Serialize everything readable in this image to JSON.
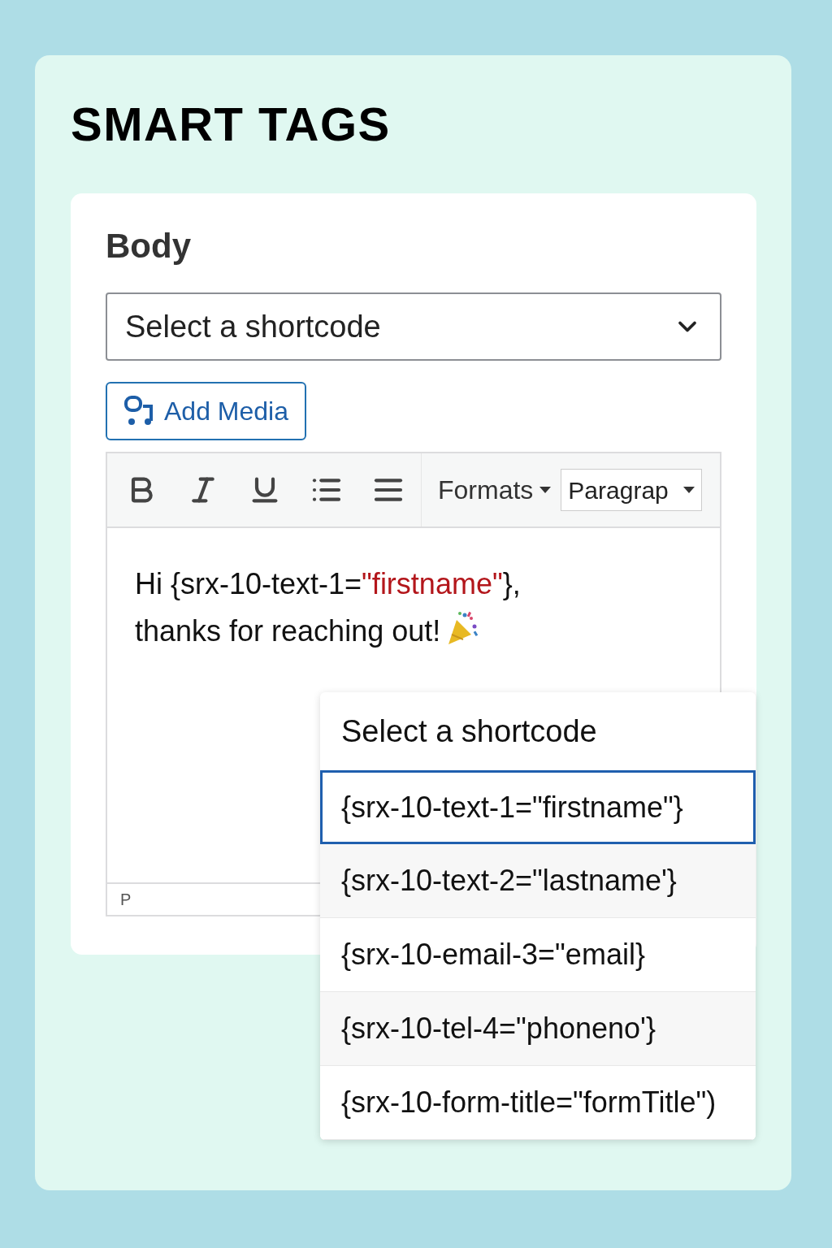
{
  "title": "SMART TAGS",
  "field_label": "Body",
  "shortcode_select": {
    "placeholder": "Select a shortcode"
  },
  "add_media_button": "Add Media",
  "toolbar": [
    {
      "kind": "bold"
    },
    {
      "kind": "italic"
    },
    {
      "kind": "underline"
    },
    {
      "kind": "bullet-list"
    },
    {
      "kind": "align"
    }
  ],
  "formats_menu": "Formats",
  "block_select": "Paragrap",
  "body_lines": [
    {
      "segments": [
        {
          "text": "Hi {srx-10-text-1=",
          "highlight": false
        },
        {
          "text": "\"firstname\"",
          "highlight": true
        },
        {
          "text": "},",
          "highlight": false
        }
      ],
      "party": false
    },
    {
      "segments": [
        {
          "text": "thanks for reaching out!",
          "highlight": false
        }
      ],
      "party": true
    }
  ],
  "status_path": "P",
  "dropdown": {
    "header": "Select a shortcode",
    "options": [
      {
        "label": "{srx-10-text-1=\"firstname\"}",
        "selected": true
      },
      {
        "label": "{srx-10-text-2=\"lastname'}",
        "selected": false
      },
      {
        "label": "{srx-10-email-3=\"email}",
        "selected": false
      },
      {
        "label": "{srx-10-tel-4=\"phoneno'}",
        "selected": false
      },
      {
        "label": "{srx-10-form-title=\"formTitle\")",
        "selected": false
      }
    ]
  }
}
